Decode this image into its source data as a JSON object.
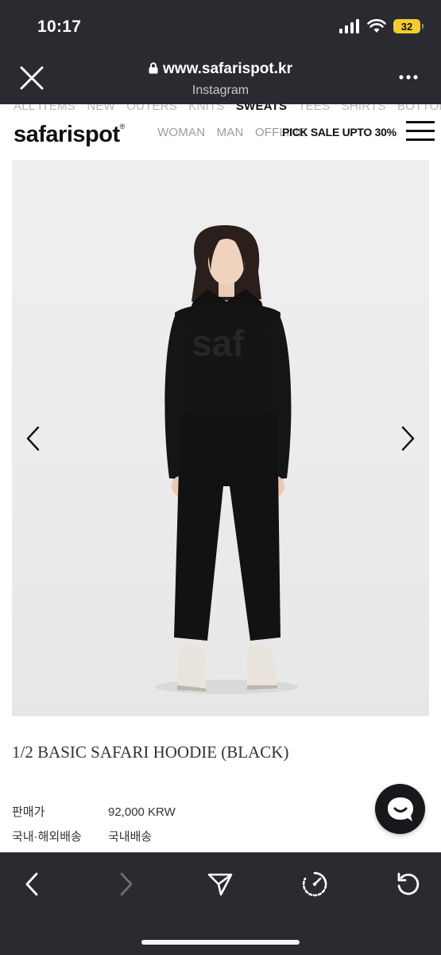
{
  "status_bar": {
    "time": "10:17",
    "battery": "32"
  },
  "browser": {
    "url": "www.safarispot.kr",
    "source": "Instagram"
  },
  "site": {
    "categories": [
      "ALL ITEMS",
      "NEW",
      "OUTERS",
      "KNITS",
      "SWEATS",
      "TEES",
      "SHIRTS",
      "BOTTOM"
    ],
    "active_category": "SWEATS",
    "logo": "safarispot",
    "logo_mark": "®",
    "nav": [
      "WOMAN",
      "MAN",
      "OFFLINE"
    ],
    "promo": "PICK SALE UPTO 30%"
  },
  "product": {
    "title": "1/2 BASIC SAFARI HOODIE (BLACK)",
    "hoodie_print": "saf",
    "price_label": "판매가",
    "price": "92,000 KRW",
    "shipping_label": "국내·해외배송",
    "shipping": "국내배송"
  },
  "icons": {
    "close": "close-icon",
    "lock": "lock-icon",
    "more": "more-icon",
    "menu": "hamburger-menu-icon",
    "prev": "chevron-left-icon",
    "next": "chevron-right-icon",
    "chat": "chat-icon",
    "back": "back-icon",
    "forward": "forward-icon",
    "share": "share-icon",
    "speed": "speed-icon",
    "reload": "reload-icon"
  },
  "colors": {
    "chrome": "#2a2b30",
    "battery": "#f2cc2f",
    "accent_text": "#111111"
  }
}
